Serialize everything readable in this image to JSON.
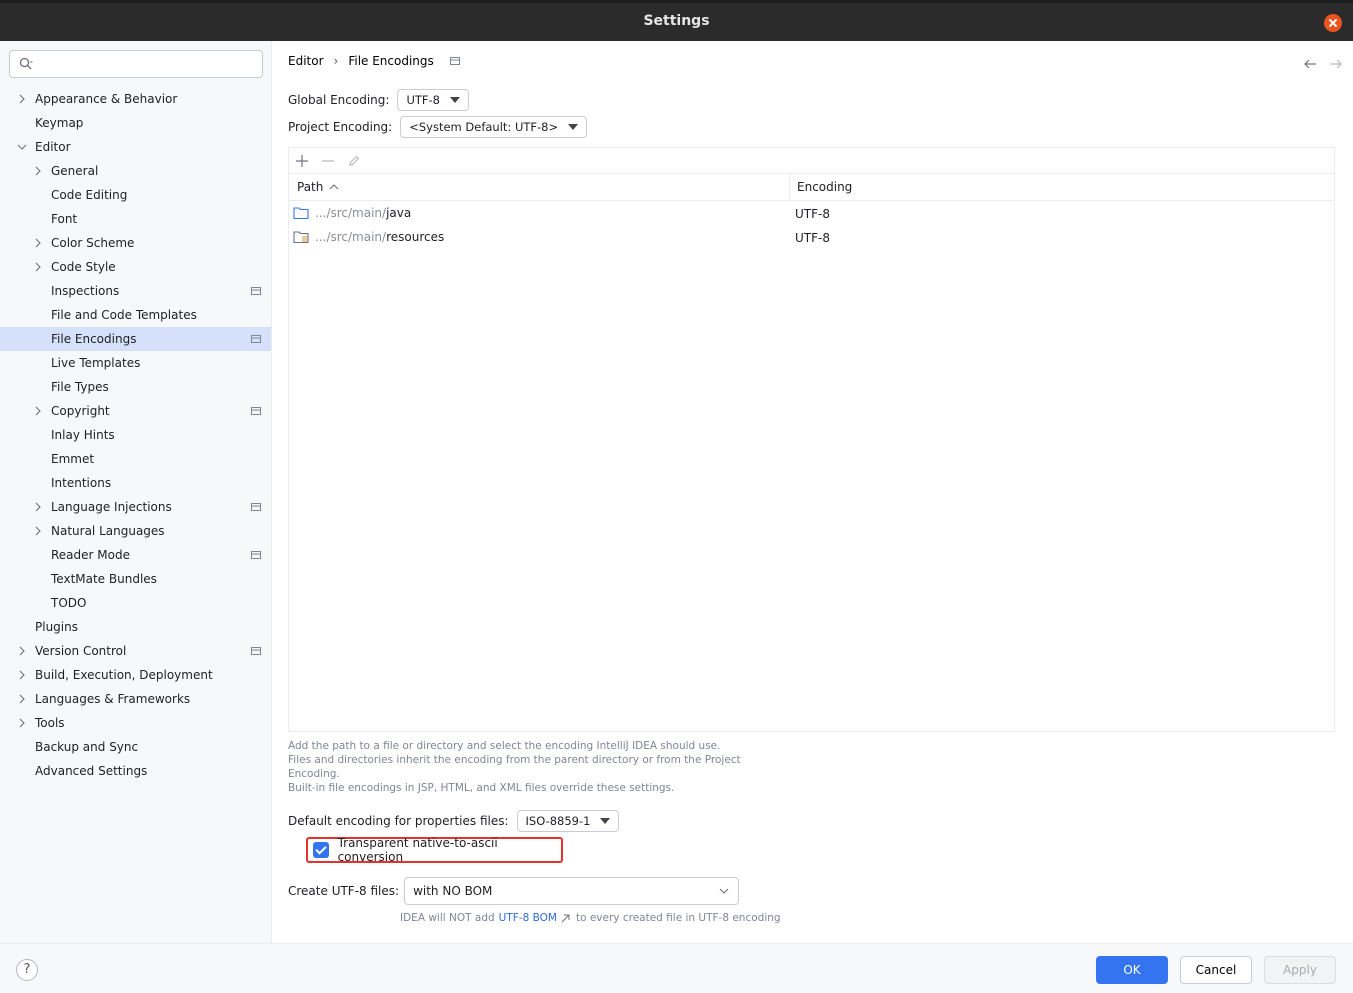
{
  "window": {
    "title": "Settings"
  },
  "search": {
    "placeholder": ""
  },
  "sidebar": {
    "items": [
      {
        "label": "Appearance & Behavior",
        "level": 0,
        "expandable": true,
        "expanded": false,
        "bold": true,
        "projectIcon": false
      },
      {
        "label": "Keymap",
        "level": 0,
        "expandable": false,
        "bold": true,
        "projectIcon": false
      },
      {
        "label": "Editor",
        "level": 0,
        "expandable": true,
        "expanded": true,
        "bold": true,
        "projectIcon": false
      },
      {
        "label": "General",
        "level": 1,
        "expandable": true,
        "expanded": false,
        "projectIcon": false
      },
      {
        "label": "Code Editing",
        "level": 1,
        "expandable": false,
        "projectIcon": false
      },
      {
        "label": "Font",
        "level": 1,
        "expandable": false,
        "projectIcon": false
      },
      {
        "label": "Color Scheme",
        "level": 1,
        "expandable": true,
        "expanded": false,
        "projectIcon": false
      },
      {
        "label": "Code Style",
        "level": 1,
        "expandable": true,
        "expanded": false,
        "projectIcon": false
      },
      {
        "label": "Inspections",
        "level": 1,
        "expandable": false,
        "projectIcon": true
      },
      {
        "label": "File and Code Templates",
        "level": 1,
        "expandable": false,
        "projectIcon": false
      },
      {
        "label": "File Encodings",
        "level": 1,
        "expandable": false,
        "projectIcon": true,
        "selected": true
      },
      {
        "label": "Live Templates",
        "level": 1,
        "expandable": false,
        "projectIcon": false
      },
      {
        "label": "File Types",
        "level": 1,
        "expandable": false,
        "projectIcon": false
      },
      {
        "label": "Copyright",
        "level": 1,
        "expandable": true,
        "expanded": false,
        "projectIcon": true
      },
      {
        "label": "Inlay Hints",
        "level": 1,
        "expandable": false,
        "projectIcon": false
      },
      {
        "label": "Emmet",
        "level": 1,
        "expandable": false,
        "projectIcon": false
      },
      {
        "label": "Intentions",
        "level": 1,
        "expandable": false,
        "projectIcon": false
      },
      {
        "label": "Language Injections",
        "level": 1,
        "expandable": true,
        "expanded": false,
        "projectIcon": true
      },
      {
        "label": "Natural Languages",
        "level": 1,
        "expandable": true,
        "expanded": false,
        "projectIcon": false
      },
      {
        "label": "Reader Mode",
        "level": 1,
        "expandable": false,
        "projectIcon": true
      },
      {
        "label": "TextMate Bundles",
        "level": 1,
        "expandable": false,
        "projectIcon": false
      },
      {
        "label": "TODO",
        "level": 1,
        "expandable": false,
        "projectIcon": false
      },
      {
        "label": "Plugins",
        "level": 0,
        "expandable": false,
        "bold": true,
        "projectIcon": false
      },
      {
        "label": "Version Control",
        "level": 0,
        "expandable": true,
        "expanded": false,
        "bold": true,
        "projectIcon": true
      },
      {
        "label": "Build, Execution, Deployment",
        "level": 0,
        "expandable": true,
        "expanded": false,
        "bold": true,
        "projectIcon": false
      },
      {
        "label": "Languages & Frameworks",
        "level": 0,
        "expandable": true,
        "expanded": false,
        "bold": true,
        "projectIcon": false
      },
      {
        "label": "Tools",
        "level": 0,
        "expandable": true,
        "expanded": false,
        "bold": true,
        "projectIcon": false
      },
      {
        "label": "Backup and Sync",
        "level": 0,
        "expandable": false,
        "bold": true,
        "projectIcon": false
      },
      {
        "label": "Advanced Settings",
        "level": 0,
        "expandable": false,
        "bold": true,
        "projectIcon": false
      }
    ]
  },
  "breadcrumb": {
    "parent": "Editor",
    "sep": "›",
    "current": "File Encodings"
  },
  "form": {
    "global_encoding_label": "Global Encoding:",
    "global_encoding_value": "UTF-8",
    "project_encoding_label": "Project Encoding:",
    "project_encoding_value": "<System Default: UTF-8>"
  },
  "table": {
    "col_path": "Path",
    "col_encoding": "Encoding",
    "rows": [
      {
        "path_prefix": ".../src/main/",
        "path_name": "java",
        "encoding": "UTF-8",
        "icon": "folder-source-icon"
      },
      {
        "path_prefix": ".../src/main/",
        "path_name": "resources",
        "encoding": "UTF-8",
        "icon": "folder-resources-icon"
      }
    ]
  },
  "hint": {
    "line1": "Add the path to a file or directory and select the encoding IntelliJ IDEA should use.",
    "line2": "Files and directories inherit the encoding from the parent directory or from the Project Encoding.",
    "line3": "Built-in file encodings in JSP, HTML, and XML files override these settings."
  },
  "properties": {
    "label": "Default encoding for properties files:",
    "value": "ISO-8859-1",
    "checkbox_label": "Transparent native-to-ascii conversion",
    "checkbox_checked": true
  },
  "utf8": {
    "label": "Create UTF-8 files:",
    "value": "with NO BOM",
    "note_prefix": "IDEA will NOT add",
    "note_link": "UTF-8 BOM",
    "note_suffix": "to every created file in UTF-8 encoding"
  },
  "buttons": {
    "help": "?",
    "ok": "OK",
    "cancel": "Cancel",
    "apply": "Apply"
  },
  "colors": {
    "accent": "#3574f0",
    "highlight": "#e63131",
    "selected_row": "#d5e1fb",
    "titlebar": "#2b2b2b"
  }
}
